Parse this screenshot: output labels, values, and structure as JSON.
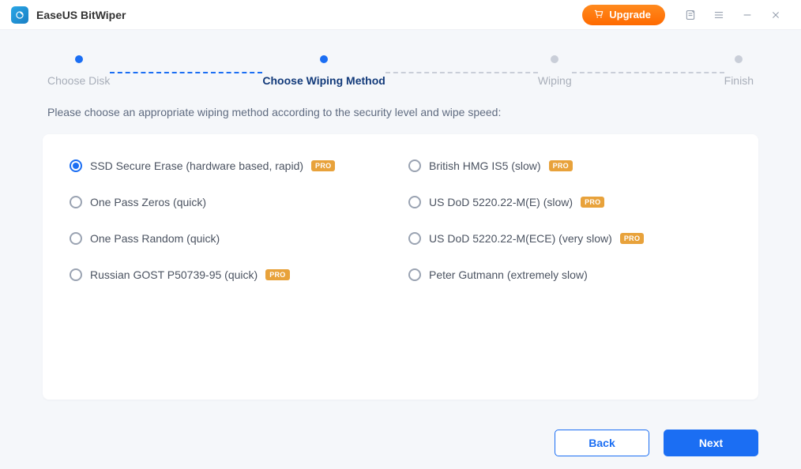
{
  "titlebar": {
    "app_name": "EaseUS BitWiper",
    "upgrade_label": "Upgrade"
  },
  "stepper": {
    "steps": [
      {
        "label": "Choose Disk",
        "state": "done"
      },
      {
        "label": "Choose Wiping Method",
        "state": "active"
      },
      {
        "label": "Wiping",
        "state": "pending"
      },
      {
        "label": "Finish",
        "state": "pending"
      }
    ]
  },
  "instruction": "Please choose an appropriate wiping method according to the security level and wipe speed:",
  "options": [
    {
      "label": "SSD Secure Erase (hardware based, rapid)",
      "pro": true,
      "selected": true
    },
    {
      "label": "British HMG IS5 (slow)",
      "pro": true,
      "selected": false
    },
    {
      "label": "One Pass Zeros (quick)",
      "pro": false,
      "selected": false
    },
    {
      "label": "US DoD 5220.22-M(E) (slow)",
      "pro": true,
      "selected": false
    },
    {
      "label": "One Pass Random (quick)",
      "pro": false,
      "selected": false
    },
    {
      "label": "US DoD 5220.22-M(ECE) (very slow)",
      "pro": true,
      "selected": false
    },
    {
      "label": "Russian GOST P50739-95 (quick)",
      "pro": true,
      "selected": false
    },
    {
      "label": "Peter Gutmann (extremely slow)",
      "pro": false,
      "selected": false
    }
  ],
  "badges": {
    "pro": "PRO"
  },
  "footer": {
    "back_label": "Back",
    "next_label": "Next"
  }
}
